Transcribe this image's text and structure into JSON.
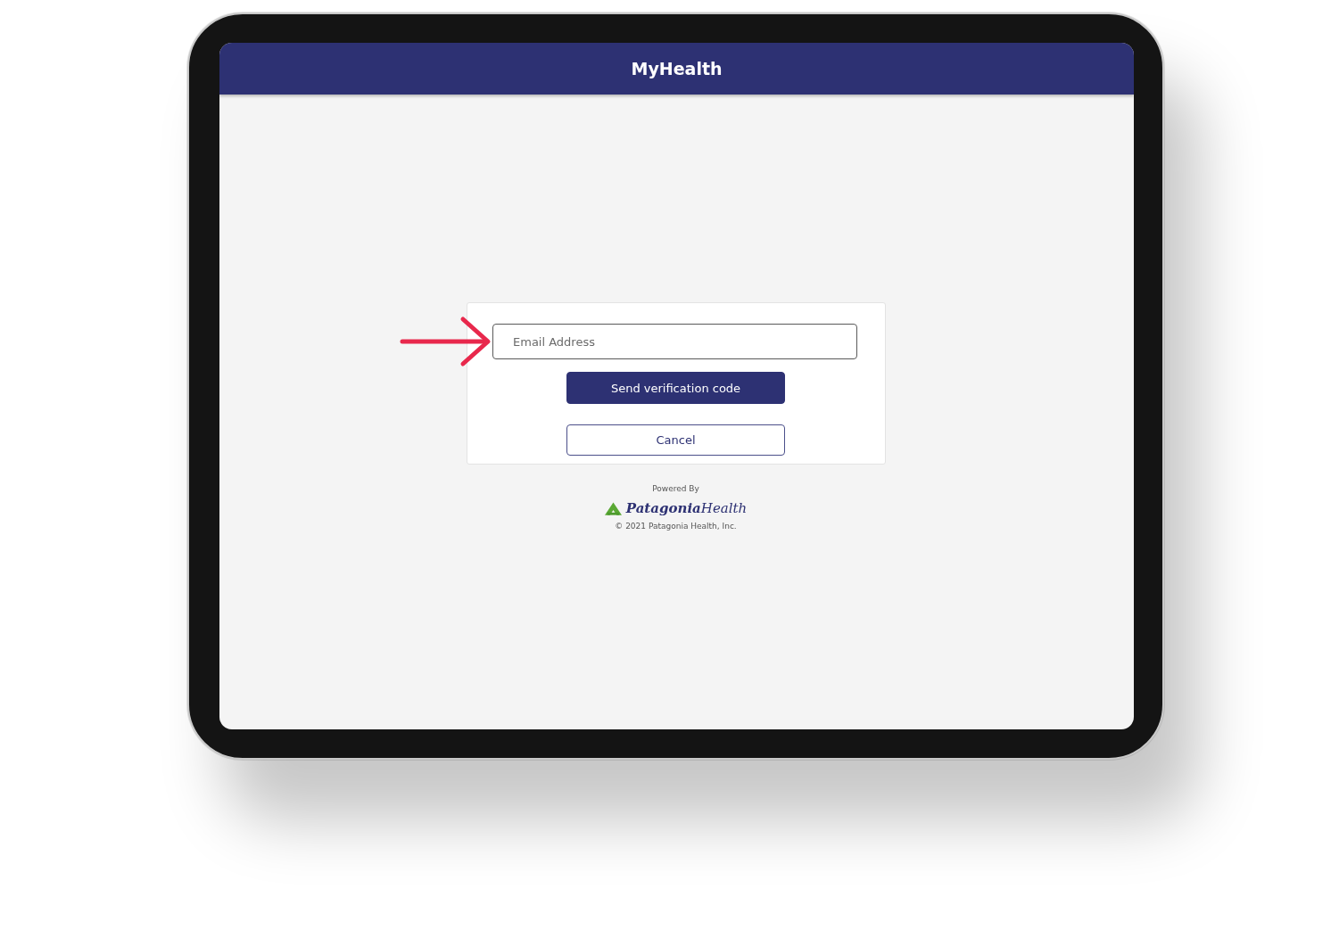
{
  "header": {
    "title": "MyHealth"
  },
  "form": {
    "email_field": {
      "placeholder": "Email Address"
    },
    "buttons": [
      {
        "label": "Send verification code",
        "kind": "primary"
      },
      {
        "label": "Cancel",
        "kind": "secondary"
      }
    ]
  },
  "footer": {
    "powered_by": "Powered By",
    "brand": "**Patagonia**Health",
    "copyright": "© 2021 Patagonia Health, Inc."
  }
}
